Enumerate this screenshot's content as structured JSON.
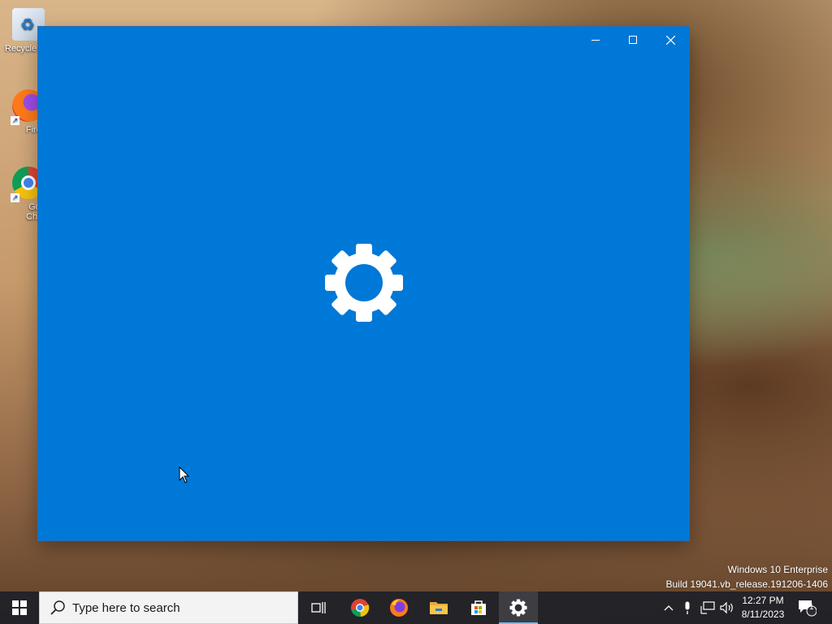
{
  "desktop": {
    "icons": [
      {
        "label": "Recycle",
        "icon": "recycle-bin-icon"
      },
      {
        "label": "Firefo",
        "icon": "firefox-icon"
      },
      {
        "label": "Goog Chron",
        "icon": "chrome-icon"
      }
    ]
  },
  "window": {
    "background": "#0078d7",
    "splash_icon": "gear-icon",
    "controls": [
      "minimize",
      "maximize",
      "close"
    ]
  },
  "watermark": {
    "line1": "Windows 10 Enterprise",
    "line2": "Build 19041.vb_release.191206-1406"
  },
  "taskbar": {
    "search_placeholder": "Type here to search",
    "apps": [
      "task-view",
      "chrome",
      "firefox",
      "file-explorer",
      "microsoft-store",
      "settings"
    ],
    "active_app": "settings",
    "clock": {
      "time": "12:27 PM",
      "date": "8/11/2023"
    },
    "notification_count": "1"
  }
}
